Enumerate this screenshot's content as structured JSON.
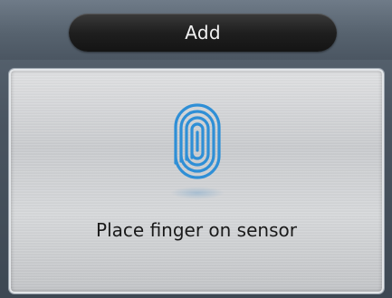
{
  "header": {
    "title": "Add"
  },
  "main": {
    "message": "Place finger on sensor"
  },
  "colors": {
    "fingerprint": "#2f8fd6",
    "title_bar": "#1a1a1a",
    "panel": "#d2d4d6"
  },
  "icons": {
    "fingerprint": "fingerprint-icon"
  }
}
